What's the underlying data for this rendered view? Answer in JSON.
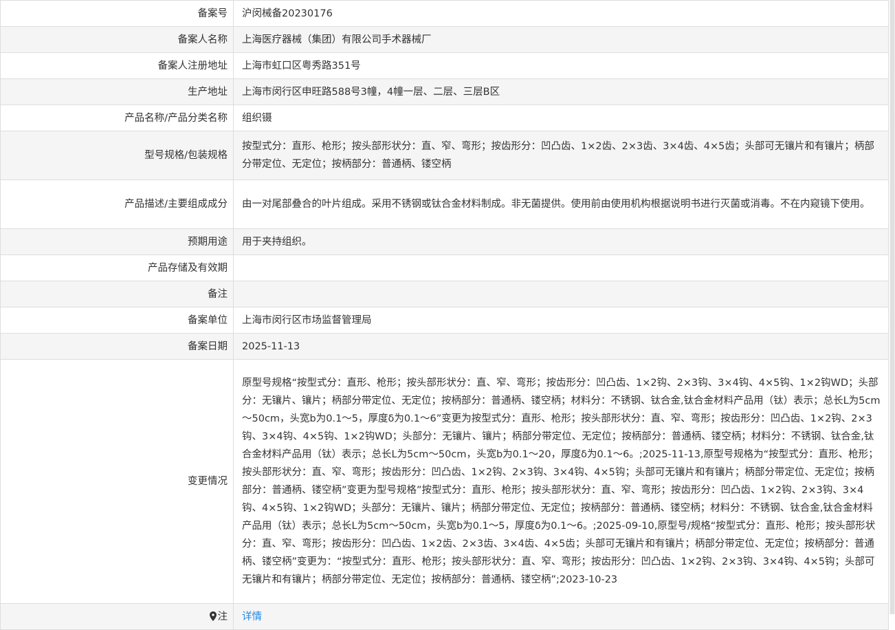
{
  "rows": [
    {
      "label": "备案号",
      "value": "沪闵械备20230176"
    },
    {
      "label": "备案人名称",
      "value": "上海医疗器械（集团）有限公司手术器械厂"
    },
    {
      "label": "备案人注册地址",
      "value": "上海市虹口区粤秀路351号"
    },
    {
      "label": "生产地址",
      "value": "上海市闵行区申旺路588号3幢，4幢一层、二层、三层B区"
    },
    {
      "label": "产品名称/产品分类名称",
      "value": "组织镊"
    },
    {
      "label": "型号规格/包装规格",
      "value": "按型式分：直形、枪形；按头部形状分：直、窄、弯形；按齿形分：凹凸齿、1×2齿、2×3齿、3×4齿、4×5齿；头部可无镶片和有镶片；柄部分带定位、无定位；按柄部分：普通柄、镂空柄"
    },
    {
      "label": "产品描述/主要组成成分",
      "value": "由一对尾部叠合的叶片组成。采用不锈钢或钛合金材料制成。非无菌提供。使用前由使用机构根据说明书进行灭菌或消毒。不在内窥镜下使用。"
    },
    {
      "label": "预期用途",
      "value": "用于夹持组织。"
    },
    {
      "label": "产品存储及有效期",
      "value": ""
    },
    {
      "label": "备注",
      "value": ""
    },
    {
      "label": "备案单位",
      "value": "上海市闵行区市场监督管理局"
    },
    {
      "label": "备案日期",
      "value": "2025-11-13"
    },
    {
      "label": "变更情况",
      "value": "原型号规格“按型式分：直形、枪形；按头部形状分：直、窄、弯形；按齿形分：凹凸齿、1×2钩、2×3钩、3×4钩、4×5钩、1×2钩WD；头部分：无镶片、镶片；柄部分带定位、无定位；按柄部分：普通柄、镂空柄；材料分：不锈钢、钛合金,钛合金材料产品用（钛）表示；总长L为5cm～50cm，头宽b为0.1～5，厚度δ为0.1～6”变更为按型式分：直形、枪形；按头部形状分：直、窄、弯形；按齿形分：凹凸齿、1×2钩、2×3钩、3×4钩、4×5钩、1×2钩WD；头部分：无镶片、镶片；柄部分带定位、无定位；按柄部分：普通柄、镂空柄；材料分：不锈钢、钛合金,钛合金材料产品用（钛）表示；总长L为5cm～50cm，头宽b为0.1～20，厚度δ为0.1～6。;2025-11-13,原型号规格为“按型式分：直形、枪形；按头部形状分：直、窄、弯形；按齿形分：凹凸齿、1×2钩、2×3钩、3×4钩、4×5钩；头部可无镶片和有镶片；柄部分带定位、无定位；按柄部分：普通柄、镂空柄”变更为型号规格”按型式分：直形、枪形；按头部形状分：直、窄、弯形；按齿形分：凹凸齿、1×2钩、2×3钩、3×4钩、4×5钩、1×2钩WD；头部分：无镶片、镶片；柄部分带定位、无定位；按柄部分：普通柄、镂空柄；材料分：不锈钢、钛合金,钛合金材料产品用（钛）表示；总长L为5cm～50cm，头宽b为0.1～5，厚度δ为0.1～6。;2025-09-10,原型号/规格“按型式分：直形、枪形；按头部形状分：直、窄、弯形；按齿形分：凹凸齿、1×2齿、2×3齿、3×4齿、4×5齿；头部可无镶片和有镶片；柄部分带定位、无定位；按柄部分：普通柄、镂空柄”变更为：“按型式分：直形、枪形；按头部形状分：直、窄、弯形；按齿形分：凹凸齿、1×2钩、2×3钩、3×4钩、4×5钩；头部可无镶片和有镶片；柄部分带定位、无定位；按柄部分：普通柄、镂空柄”;2023-10-23"
    }
  ],
  "note": {
    "label": "注",
    "link": "详情",
    "icon": "location-pin-icon"
  },
  "colors": {
    "row_alt": "#f5f5f5",
    "border": "#dddddd",
    "link": "#1e88e5",
    "text": "#333333"
  }
}
